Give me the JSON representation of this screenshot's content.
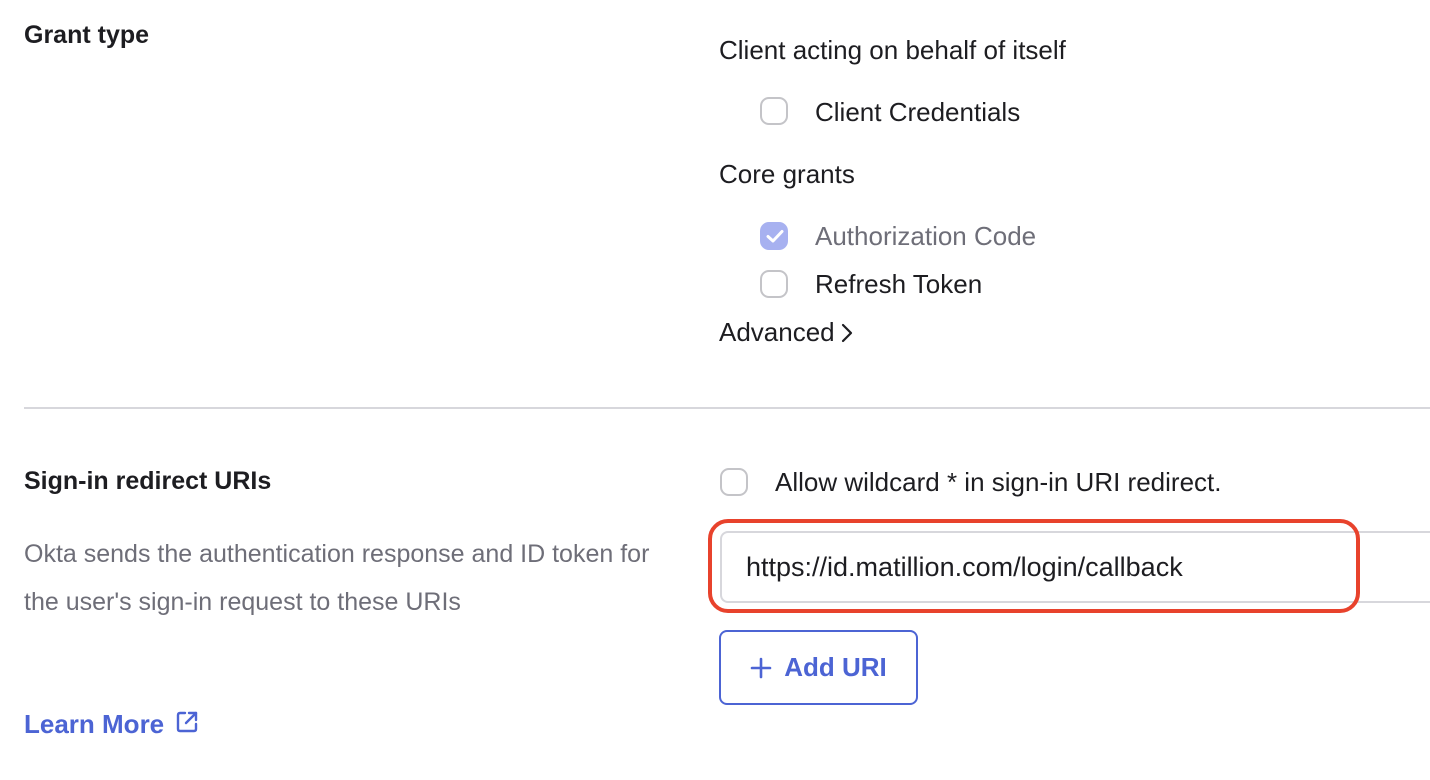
{
  "grant_type": {
    "title": "Grant type",
    "self_group_label": "Client acting on behalf of itself",
    "client_credentials": {
      "label": "Client Credentials",
      "checked": false
    },
    "core_group_label": "Core grants",
    "authorization_code": {
      "label": "Authorization Code",
      "checked": true,
      "disabled": true
    },
    "refresh_token": {
      "label": "Refresh Token",
      "checked": false
    },
    "advanced_label": "Advanced"
  },
  "sign_in": {
    "title": "Sign-in redirect URIs",
    "description": "Okta sends the authentication response and ID token for the user's sign-in request to these URIs",
    "learn_more": "Learn More",
    "wildcard_label": "Allow wildcard * in sign-in URI redirect.",
    "wildcard_checked": false,
    "uri_value": "https://id.matillion.com/login/callback",
    "add_uri_label": "Add URI"
  },
  "colors": {
    "accent": "#4c64d4",
    "checkbox_checked": "#a7b1f0",
    "highlight": "#e8422c",
    "muted_text": "#6e6e78"
  }
}
